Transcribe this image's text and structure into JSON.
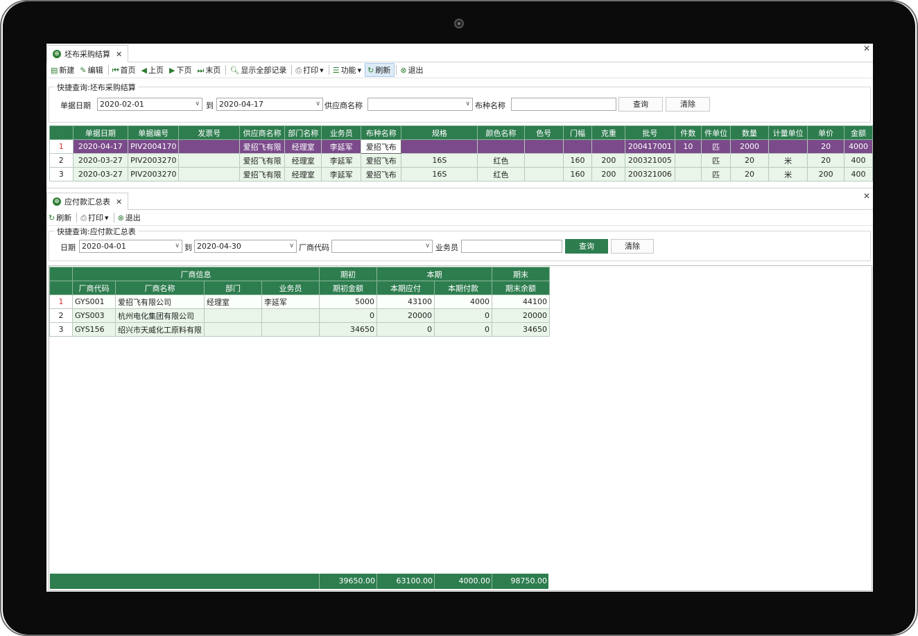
{
  "window1": {
    "tab_title": "坯布采购结算",
    "toolbar": {
      "new": "新建",
      "edit": "编辑",
      "first": "首页",
      "prev": "上页",
      "next": "下页",
      "last": "末页",
      "show_all": "显示全部记录",
      "print": "打印",
      "function": "功能",
      "refresh": "刷新",
      "exit": "退出"
    },
    "query": {
      "group_title": "快捷查询:坯布采购结算",
      "date_label": "单据日期",
      "date_from": "2020-02-01",
      "to_label": "到",
      "date_to": "2020-04-17",
      "supplier_label": "供应商名称",
      "supplier_value": "",
      "fabric_label": "布种名称",
      "fabric_value": "",
      "query_button": "查询",
      "clear_button": "清除"
    },
    "grid": {
      "columns": [
        "单据日期",
        "单据编号",
        "发票号",
        "供应商名称",
        "部门名称",
        "业务员",
        "布种名称",
        "规格",
        "颜色名称",
        "色号",
        "门幅",
        "克重",
        "批号",
        "件数",
        "件单位",
        "数量",
        "计量单位",
        "单价",
        "金额"
      ],
      "rows": [
        {
          "index": "1",
          "cells": [
            "2020-04-17",
            "PIV2004170",
            "",
            "爱招飞有限",
            "经理室",
            "李延军",
            "爱招飞布",
            "",
            "",
            "",
            "",
            "",
            "200417001",
            "10",
            "匹",
            "2000",
            "",
            "20",
            "4000"
          ]
        },
        {
          "index": "2",
          "cells": [
            "2020-03-27",
            "PIV2003270",
            "",
            "爱招飞有限",
            "经理室",
            "李延军",
            "爱招飞布",
            "16S",
            "红色",
            "",
            "160",
            "200",
            "200321005",
            "",
            "匹",
            "20",
            "米",
            "20",
            "400"
          ]
        },
        {
          "index": "3",
          "cells": [
            "2020-03-27",
            "PIV2003270",
            "",
            "爱招飞有限",
            "经理室",
            "李延军",
            "爱招飞布",
            "16S",
            "红色",
            "",
            "160",
            "200",
            "200321006",
            "",
            "匹",
            "20",
            "米",
            "200",
            "400"
          ]
        }
      ]
    }
  },
  "window2": {
    "tab_title": "应付款汇总表",
    "toolbar": {
      "refresh": "刷新",
      "print": "打印",
      "exit": "退出"
    },
    "query": {
      "group_title": "快捷查询:应付款汇总表",
      "date_label": "日期",
      "date_from": "2020-04-01",
      "to_label": "到",
      "date_to": "2020-04-30",
      "vendor_code_label": "厂商代码",
      "vendor_code_value": "",
      "salesman_label": "业务员",
      "salesman_value": "",
      "query_button": "查询",
      "clear_button": "清除"
    },
    "grid": {
      "group_headers": [
        "厂商信息",
        "期初",
        "本期",
        "期末"
      ],
      "columns": [
        "厂商代码",
        "厂商名称",
        "部门",
        "业务员",
        "期初金额",
        "本期应付",
        "本期付款",
        "期末余额"
      ],
      "rows": [
        {
          "index": "1",
          "cells": [
            "GYS001",
            "爱招飞有限公司",
            "经理室",
            "李延军",
            "5000",
            "43100",
            "4000",
            "44100"
          ]
        },
        {
          "index": "2",
          "cells": [
            "GYS003",
            "杭州电化集团有限公司",
            "",
            "",
            "0",
            "20000",
            "0",
            "20000"
          ]
        },
        {
          "index": "3",
          "cells": [
            "GYS156",
            "绍兴市天威化工原料有限",
            "",
            "",
            "34650",
            "0",
            "0",
            "34650"
          ]
        }
      ],
      "totals": [
        "39650.00",
        "63100.00",
        "4000.00",
        "98750.00"
      ]
    }
  }
}
